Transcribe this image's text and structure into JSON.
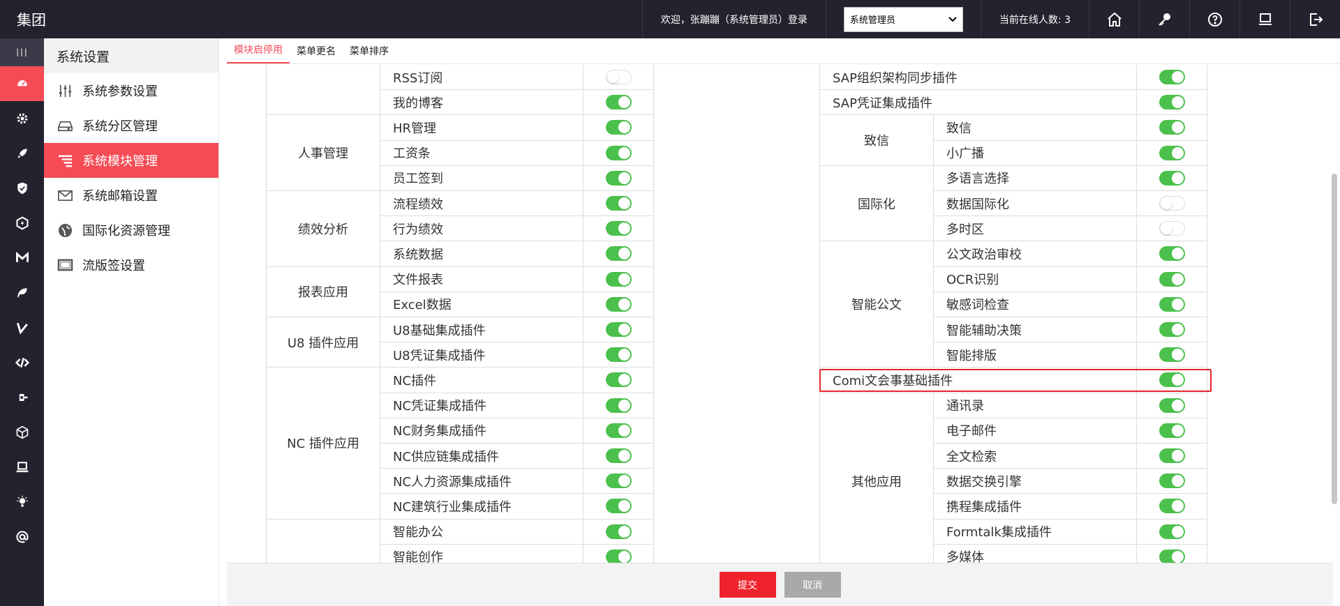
{
  "app": {
    "brand": "集团"
  },
  "header": {
    "welcome": "欢迎，张蹦蹦（系统管理员）登录",
    "role_selected": "系统管理员",
    "online_count": "当前在线人数: 3",
    "icons": [
      "home-icon",
      "key-icon",
      "help-icon",
      "monitor-icon",
      "logout-icon"
    ]
  },
  "rail": {
    "toggle": "III",
    "icons": [
      "dashboard-icon",
      "gear-icon",
      "rocket-icon",
      "shield-icon",
      "hexagon-icon",
      "mail-m-icon",
      "leaf-icon",
      "check-v-icon",
      "code-icon",
      "plug-icon",
      "cube-icon",
      "laptop-icon",
      "bulb-icon",
      "at-icon"
    ]
  },
  "sidebar": {
    "title": "系统设置",
    "items": [
      {
        "label": "系统参数设置",
        "icon": "sliders-icon"
      },
      {
        "label": "系统分区管理",
        "icon": "drive-icon"
      },
      {
        "label": "系统模块管理",
        "icon": "menu-lines-icon"
      },
      {
        "label": "系统邮箱设置",
        "icon": "envelope-icon"
      },
      {
        "label": "国际化资源管理",
        "icon": "globe-icon"
      },
      {
        "label": "流版签设置",
        "icon": "screen-icon"
      }
    ]
  },
  "tabs": [
    "模块启停用",
    "菜单更名",
    "菜单排序"
  ],
  "left_table": [
    {
      "category": "",
      "rows": [
        {
          "label": "RSS订阅",
          "on": false
        },
        {
          "label": "我的博客",
          "on": true
        }
      ]
    },
    {
      "category": "人事管理",
      "rows": [
        {
          "label": "HR管理",
          "on": true
        },
        {
          "label": "工资条",
          "on": true
        },
        {
          "label": "员工签到",
          "on": true
        }
      ]
    },
    {
      "category": "绩效分析",
      "rows": [
        {
          "label": "流程绩效",
          "on": true
        },
        {
          "label": "行为绩效",
          "on": true
        },
        {
          "label": "系统数据",
          "on": true
        }
      ]
    },
    {
      "category": "报表应用",
      "rows": [
        {
          "label": "文件报表",
          "on": true
        },
        {
          "label": "Excel数据",
          "on": true
        }
      ]
    },
    {
      "category": "U8 插件应用",
      "rows": [
        {
          "label": "U8基础集成插件",
          "on": true
        },
        {
          "label": "U8凭证集成插件",
          "on": true
        }
      ]
    },
    {
      "category": "NC 插件应用",
      "rows": [
        {
          "label": "NC插件",
          "on": true
        },
        {
          "label": "NC凭证集成插件",
          "on": true
        },
        {
          "label": "NC财务集成插件",
          "on": true
        },
        {
          "label": "NC供应链集成插件",
          "on": true
        },
        {
          "label": "NC人力资源集成插件",
          "on": true
        },
        {
          "label": "NC建筑行业集成插件",
          "on": true
        }
      ]
    },
    {
      "category": "",
      "rows": [
        {
          "label": "智能办公",
          "on": true
        },
        {
          "label": "智能创作",
          "on": true
        }
      ]
    }
  ],
  "right_table": [
    {
      "category": null,
      "rows": [
        {
          "label": "SAP组织架构同步插件",
          "on": true
        },
        {
          "label": "SAP凭证集成插件",
          "on": true
        }
      ]
    },
    {
      "category": "致信",
      "rows": [
        {
          "label": "致信",
          "on": true
        },
        {
          "label": "小广播",
          "on": true
        }
      ]
    },
    {
      "category": "国际化",
      "rows": [
        {
          "label": "多语言选择",
          "on": true
        },
        {
          "label": "数据国际化",
          "on": false
        },
        {
          "label": "多时区",
          "on": false
        }
      ]
    },
    {
      "category": "智能公文",
      "rows": [
        {
          "label": "公文政治审校",
          "on": true
        },
        {
          "label": "OCR识别",
          "on": true
        },
        {
          "label": "敏感词检查",
          "on": true
        },
        {
          "label": "智能辅助决策",
          "on": true
        },
        {
          "label": "智能排版",
          "on": true
        }
      ]
    },
    {
      "category": null,
      "rows": [
        {
          "label": "Comi文会事基础插件",
          "on": true
        }
      ]
    },
    {
      "category": "其他应用",
      "rows": [
        {
          "label": "通讯录",
          "on": true
        },
        {
          "label": "电子邮件",
          "on": true
        },
        {
          "label": "全文检索",
          "on": true
        },
        {
          "label": "数据交换引擎",
          "on": true
        },
        {
          "label": "携程集成插件",
          "on": true
        },
        {
          "label": "Formtalk集成插件",
          "on": true
        },
        {
          "label": "多媒体",
          "on": true
        }
      ]
    }
  ],
  "footer": {
    "submit": "提交",
    "cancel": "取消"
  },
  "colors": {
    "accent": "#f44b55",
    "toggle_on": "#4cc04c",
    "dark": "#23232f",
    "highlight": "#e3262c"
  }
}
